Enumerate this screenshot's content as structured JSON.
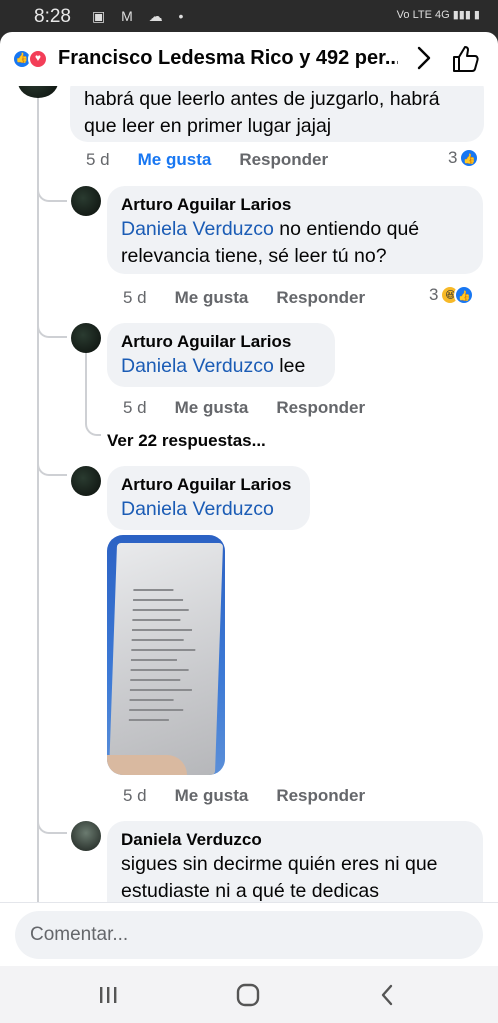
{
  "status": {
    "time": "8:28",
    "icons_left": "▣ M ☁ •",
    "icons_right": "Vo LTE 4G ▮▮▮ ▮"
  },
  "header": {
    "title": "Francisco Ledesma Rico y 492 per..."
  },
  "comments": [
    {
      "text": "habrá que leerlo antes de juzgarlo, habrá que leer en primer lugar jajaj",
      "time": "5 d",
      "like_label": "Me gusta",
      "reply_label": "Responder",
      "reaction_count": "3"
    },
    {
      "author": "Arturo Aguilar Larios",
      "mention": "Daniela Verduzco",
      "text": " no entiendo qué relevancia tiene, sé leer tú no?",
      "time": "5 d",
      "like_label": "Me gusta",
      "reply_label": "Responder",
      "reaction_count": "3"
    },
    {
      "author": "Arturo Aguilar Larios",
      "mention": "Daniela Verduzco",
      "text": " lee",
      "time": "5 d",
      "like_label": "Me gusta",
      "reply_label": "Responder"
    },
    {
      "author": "Arturo Aguilar Larios",
      "mention": "Daniela Verduzco",
      "text": "",
      "time": "5 d",
      "like_label": "Me gusta",
      "reply_label": "Responder"
    },
    {
      "author": "Daniela Verduzco",
      "text": "sigues sin decirme quién eres ni que estudiaste ni a qué te dedicas"
    }
  ],
  "view_more": "Ver 22 respuestas...",
  "composer": {
    "placeholder": "Comentar..."
  }
}
